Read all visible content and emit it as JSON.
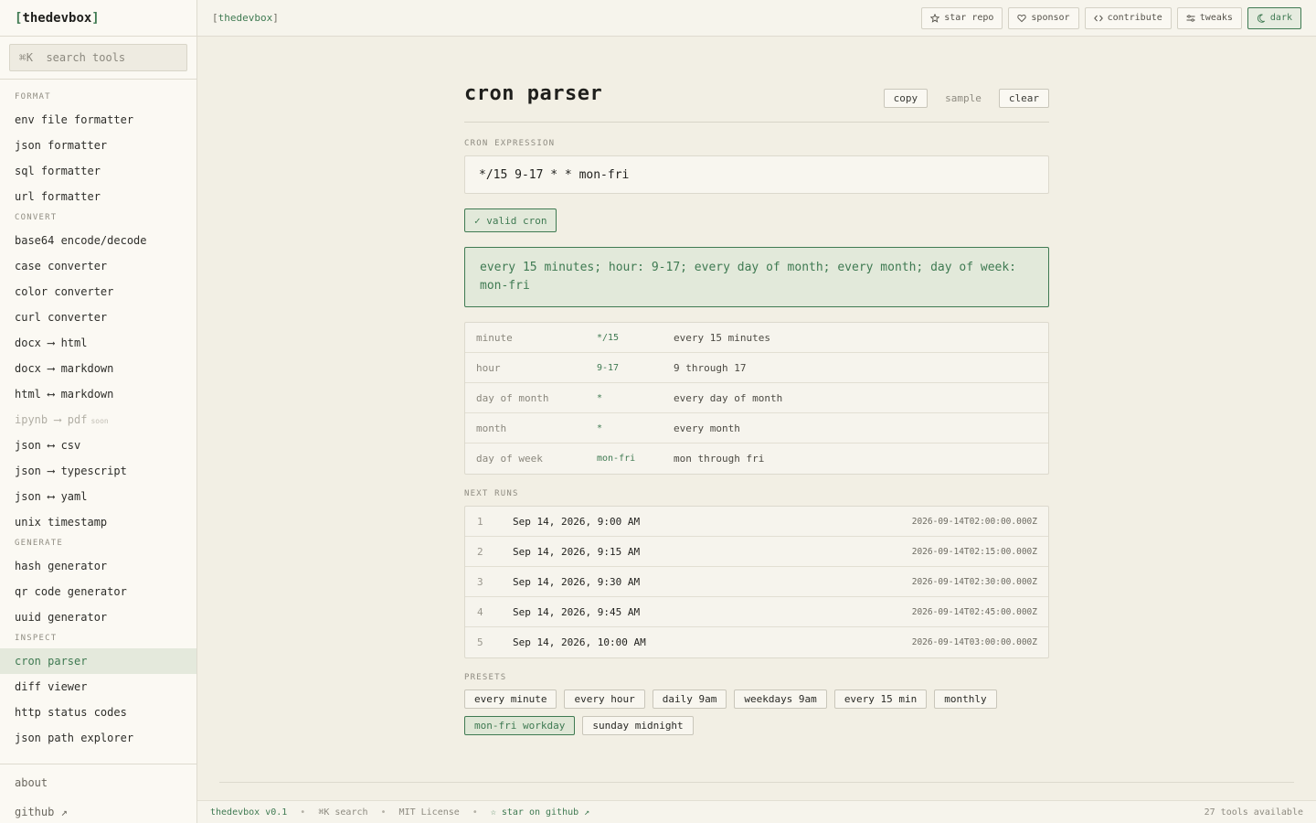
{
  "brand": {
    "open": "[",
    "name": "thedevbox",
    "close": "]"
  },
  "search": {
    "shortcut": "⌘K",
    "placeholder": "search tools"
  },
  "sidebar": {
    "groups": [
      {
        "title": "FORMAT",
        "items": [
          "env file formatter",
          "json formatter",
          "sql formatter",
          "url formatter"
        ]
      },
      {
        "title": "CONVERT",
        "items": [
          "base64 encode/decode",
          "case converter",
          "color converter",
          "curl converter",
          "docx ⟶ html",
          "docx ⟶ markdown",
          "html ⟷ markdown",
          "ipynb ⟶ pdf",
          "json ⟷ csv",
          "json ⟶ typescript",
          "json ⟷ yaml",
          "unix timestamp"
        ]
      },
      {
        "title": "GENERATE",
        "items": [
          "hash generator",
          "qr code generator",
          "uuid generator"
        ]
      },
      {
        "title": "INSPECT",
        "items": [
          "cron parser",
          "diff viewer",
          "http status codes",
          "json path explorer"
        ]
      }
    ],
    "soon_badge": "soon",
    "footer": {
      "about": "about",
      "github": "github ↗"
    }
  },
  "topbar": {
    "crumb": "thedevbox",
    "actions": {
      "star": "star repo",
      "sponsor": "sponsor",
      "contribute": "contribute",
      "tweaks": "tweaks",
      "dark": "dark"
    }
  },
  "page": {
    "title": "cron parser",
    "actions": {
      "copy": "copy",
      "sample": "sample",
      "clear": "clear"
    },
    "expression_label": "CRON EXPRESSION",
    "expression": "*/15 9-17 * * mon-fri",
    "valid_badge": "✓ valid cron",
    "description": "every 15 minutes; hour: 9-17; every day of month; every month; day of week: mon-fri",
    "fields": [
      {
        "name": "minute",
        "value": "*/15",
        "desc": "every 15 minutes"
      },
      {
        "name": "hour",
        "value": "9-17",
        "desc": "9 through 17"
      },
      {
        "name": "day of month",
        "value": "*",
        "desc": "every day of month"
      },
      {
        "name": "month",
        "value": "*",
        "desc": "every month"
      },
      {
        "name": "day of week",
        "value": "mon-fri",
        "desc": "mon through fri"
      }
    ],
    "next_runs_label": "NEXT RUNS",
    "next_runs": [
      {
        "idx": "1",
        "local": "Sep 14, 2026, 9:00 AM",
        "iso": "2026-09-14T02:00:00.000Z"
      },
      {
        "idx": "2",
        "local": "Sep 14, 2026, 9:15 AM",
        "iso": "2026-09-14T02:15:00.000Z"
      },
      {
        "idx": "3",
        "local": "Sep 14, 2026, 9:30 AM",
        "iso": "2026-09-14T02:30:00.000Z"
      },
      {
        "idx": "4",
        "local": "Sep 14, 2026, 9:45 AM",
        "iso": "2026-09-14T02:45:00.000Z"
      },
      {
        "idx": "5",
        "local": "Sep 14, 2026, 10:00 AM",
        "iso": "2026-09-14T03:00:00.000Z"
      }
    ],
    "presets_label": "PRESETS",
    "presets": [
      "every minute",
      "every hour",
      "daily 9am",
      "weekdays 9am",
      "every 15 min",
      "monthly",
      "mon-fri workday",
      "sunday midnight"
    ]
  },
  "footer": {
    "version": "thedevbox v0.1",
    "search": "⌘K search",
    "license": "MIT License",
    "star": "☆ star on github ↗",
    "count": "27 tools available"
  },
  "colors": {
    "accent": "#3f7a52",
    "background": "#f2efe4",
    "sidebar": "#fbf9f3"
  }
}
